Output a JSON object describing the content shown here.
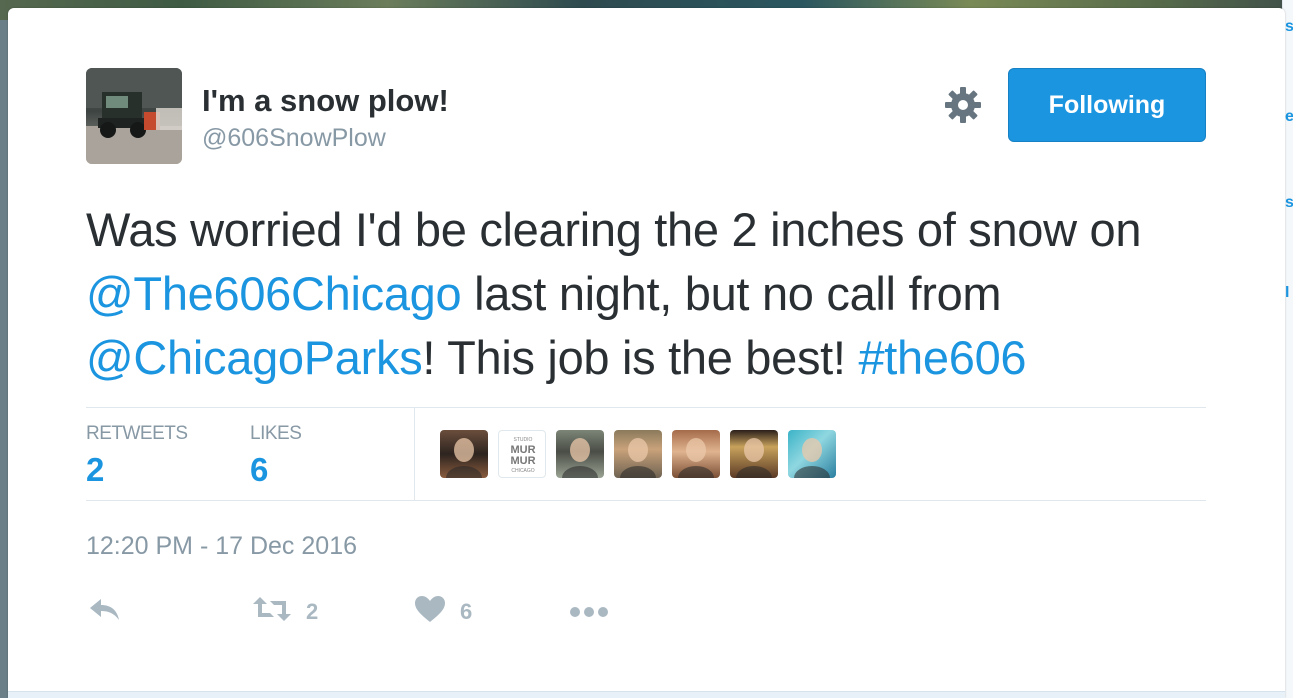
{
  "author": {
    "name": "I'm a snow plow!",
    "handle": "@606SnowPlow"
  },
  "follow_button": {
    "label": "Following"
  },
  "tweet": {
    "segments": [
      {
        "text": "Was worried I'd be clearing the 2 inches of snow on ",
        "link": false
      },
      {
        "text": "@The606Chicago",
        "link": true
      },
      {
        "text": " last night, but no call from ",
        "link": false
      },
      {
        "text": "@ChicagoParks",
        "link": true
      },
      {
        "text": "! This job is the best! ",
        "link": false
      },
      {
        "text": "#the606",
        "link": true
      }
    ]
  },
  "stats": {
    "retweets_label": "RETWEETS",
    "retweets_count": "2",
    "likes_label": "LIKES",
    "likes_count": "6"
  },
  "likers": [
    {
      "name": "liker-avatar-1",
      "logo_text": ""
    },
    {
      "name": "liker-avatar-studio-mur-mur",
      "logo_text": "STUDIO MUR MUR CHICAGO"
    },
    {
      "name": "liker-avatar-3",
      "logo_text": ""
    },
    {
      "name": "liker-avatar-4",
      "logo_text": ""
    },
    {
      "name": "liker-avatar-5",
      "logo_text": ""
    },
    {
      "name": "liker-avatar-6",
      "logo_text": ""
    },
    {
      "name": "liker-avatar-7",
      "logo_text": ""
    }
  ],
  "timestamp": "12:20 PM - 17 Dec 2016",
  "actions": {
    "reply_icon": "reply-icon",
    "retweet_icon": "retweet-icon",
    "retweet_count": "2",
    "like_icon": "heart-icon",
    "like_count": "6",
    "more_icon": "more-icon"
  },
  "colors": {
    "link": "#1b95e0",
    "text": "#292f33",
    "muted": "#8899a6",
    "icon": "#aab8c2",
    "button": "#1b95e0"
  }
}
